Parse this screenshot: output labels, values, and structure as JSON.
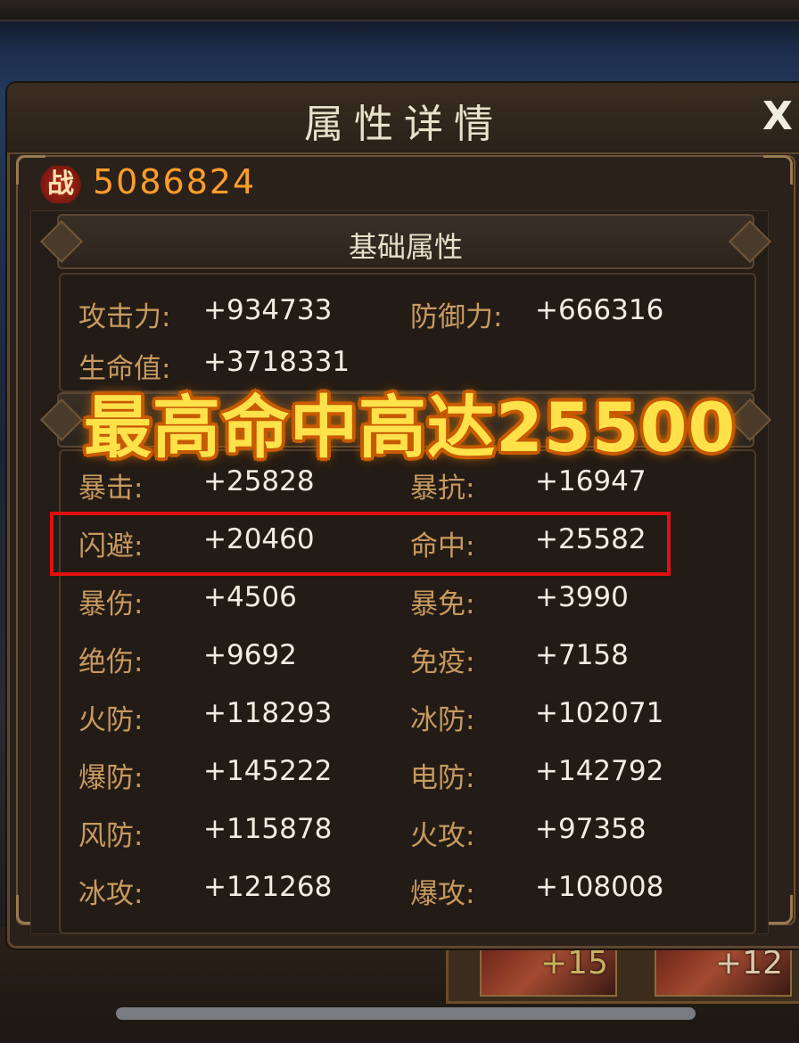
{
  "window": {
    "title": "属性详情",
    "close_label": "X"
  },
  "power": {
    "icon_label": "战",
    "value": "5086824"
  },
  "basic_section": {
    "title": "基础属性",
    "stats": [
      {
        "label": "攻击力:",
        "value": "+934733"
      },
      {
        "label": "防御力:",
        "value": "+666316"
      },
      {
        "label": "生命值:",
        "value": "+3718331"
      }
    ]
  },
  "advanced_stats": [
    {
      "label": "暴击:",
      "value": "+25828"
    },
    {
      "label": "暴抗:",
      "value": "+16947"
    },
    {
      "label": "闪避:",
      "value": "+20460"
    },
    {
      "label": "命中:",
      "value": "+25582"
    },
    {
      "label": "暴伤:",
      "value": "+4506"
    },
    {
      "label": "暴免:",
      "value": "+3990"
    },
    {
      "label": "绝伤:",
      "value": "+9692"
    },
    {
      "label": "免疫:",
      "value": "+7158"
    },
    {
      "label": "火防:",
      "value": "+118293"
    },
    {
      "label": "冰防:",
      "value": "+102071"
    },
    {
      "label": "爆防:",
      "value": "+145222"
    },
    {
      "label": "电防:",
      "value": "+142792"
    },
    {
      "label": "风防:",
      "value": "+115878"
    },
    {
      "label": "火攻:",
      "value": "+97358"
    },
    {
      "label": "冰攻:",
      "value": "+121268"
    },
    {
      "label": "爆攻:",
      "value": "+108008"
    }
  ],
  "overlay_caption": "最高命中高达25500",
  "background": {
    "hero_cards": [
      {
        "level": "+15"
      },
      {
        "level": "+12"
      }
    ]
  },
  "colors": {
    "label": "#c79a60",
    "value": "#f2ede2",
    "power": "#ff9d2a",
    "highlight_box": "#e01010",
    "caption": "#ffe24a"
  }
}
